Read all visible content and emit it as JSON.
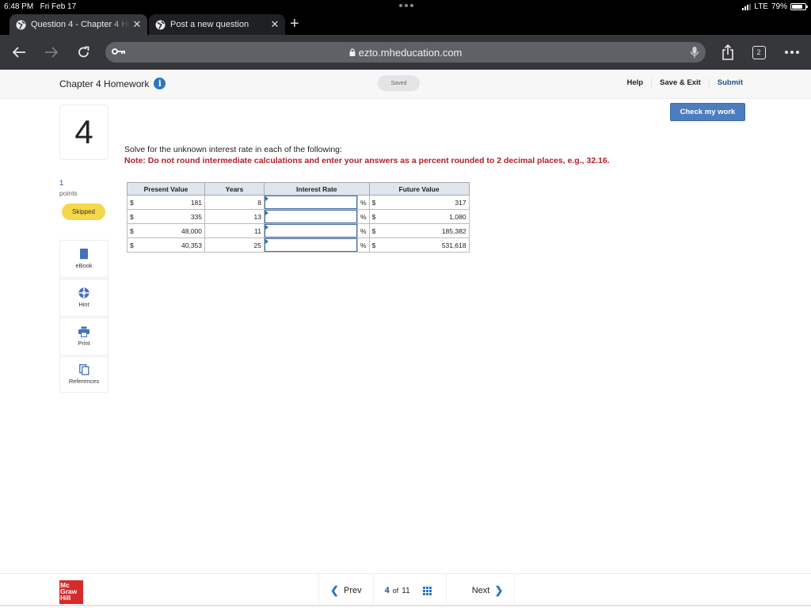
{
  "status_bar": {
    "time": "6:48 PM",
    "date": "Fri Feb 17",
    "network": "LTE",
    "battery": "79%",
    "battery_level": 0.79
  },
  "browser": {
    "tabs": [
      {
        "title": "Question 4 - Chapter 4 Homework",
        "active": true,
        "icon": "globe-icon"
      },
      {
        "title": "Post a new question",
        "active": false,
        "icon": "globe-icon"
      }
    ],
    "url": "ezto.mheducation.com",
    "tab_count": "2"
  },
  "header": {
    "assignment_title": "Chapter 4 Homework",
    "save_status": "Saved",
    "links": {
      "help": "Help",
      "save_exit": "Save & Exit",
      "submit": "Submit"
    },
    "check_my_work": "Check my work"
  },
  "question": {
    "number": "4",
    "points_value": "1",
    "points_label": "points",
    "status_badge": "Skipped",
    "prompt": "Solve for the unknown interest rate in each of the following:",
    "note": "Note: Do not round intermediate calculations and enter your answers as a percent rounded to 2 decimal places, e.g., 32.16."
  },
  "side_tools": [
    {
      "label": "eBook",
      "icon": "book-icon"
    },
    {
      "label": "Hint",
      "icon": "lifebuoy-icon"
    },
    {
      "label": "Print",
      "icon": "printer-icon"
    },
    {
      "label": "References",
      "icon": "copy-icon"
    }
  ],
  "table": {
    "headers": [
      "Present Value",
      "Years",
      "Interest Rate",
      "Future Value"
    ],
    "currency_symbol": "$",
    "percent_symbol": "%",
    "rows": [
      {
        "present_value": "181",
        "years": "8",
        "interest_rate": "",
        "future_value": "317"
      },
      {
        "present_value": "335",
        "years": "13",
        "interest_rate": "",
        "future_value": "1,080"
      },
      {
        "present_value": "48,000",
        "years": "11",
        "interest_rate": "",
        "future_value": "185,382"
      },
      {
        "present_value": "40,353",
        "years": "25",
        "interest_rate": "",
        "future_value": "531,618"
      }
    ]
  },
  "footer": {
    "logo_text": [
      "Mc",
      "Graw",
      "Hill"
    ],
    "prev_label": "Prev",
    "current_page": "4",
    "of_label": "of",
    "total_pages": "11",
    "next_label": "Next"
  }
}
